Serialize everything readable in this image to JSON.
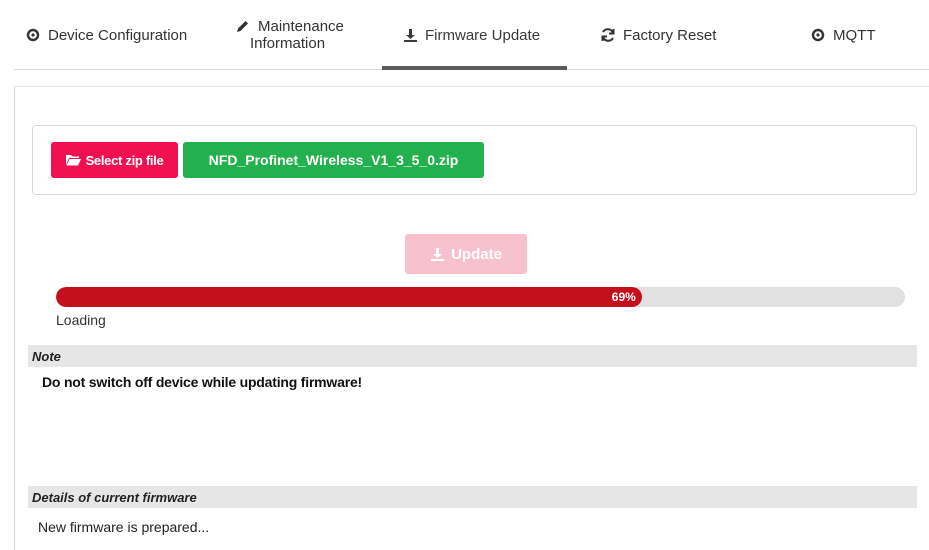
{
  "tabs": [
    {
      "label": "Device Configuration",
      "icon": "gear-icon"
    },
    {
      "label_line1": "Maintenance",
      "label_line2": "Information",
      "icon": "pencil-icon"
    },
    {
      "label": "Firmware Update",
      "icon": "download-icon",
      "active": true
    },
    {
      "label": "Factory Reset",
      "icon": "refresh-icon"
    },
    {
      "label": "MQTT",
      "icon": "gear-icon"
    }
  ],
  "upload": {
    "select_label": "Select zip file",
    "file_name": "NFD_Profinet_Wireless_V1_3_5_0.zip"
  },
  "update_button": {
    "label": "Update"
  },
  "progress": {
    "percent": 69,
    "label": "69%",
    "status": "Loading"
  },
  "note": {
    "heading": "Note",
    "text": "Do not switch off device while updating firmware!"
  },
  "details": {
    "heading": "Details of current firmware",
    "text": "New firmware is prepared..."
  },
  "colors": {
    "select_button": "#f0104f",
    "file_badge": "#23b14d",
    "update_button_disabled": "#f7c2cd",
    "progress_fill": "#c50f1c",
    "progress_track": "#e1e1e1",
    "section_header": "#e6e6e6"
  }
}
